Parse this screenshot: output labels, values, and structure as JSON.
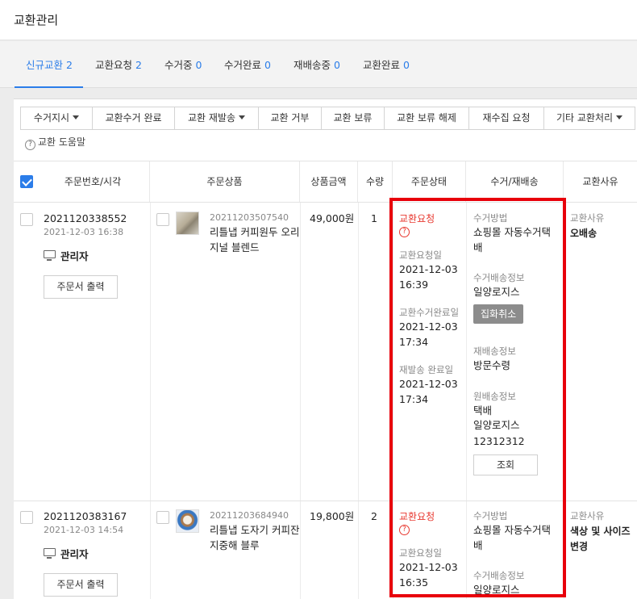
{
  "page_title": "교환관리",
  "tabs": [
    {
      "label": "신규교환",
      "count": "2"
    },
    {
      "label": "교환요청",
      "count": "2"
    },
    {
      "label": "수거중",
      "count": "0"
    },
    {
      "label": "수거완료",
      "count": "0"
    },
    {
      "label": "재배송중",
      "count": "0"
    },
    {
      "label": "교환완료",
      "count": "0"
    }
  ],
  "toolbar": {
    "pickup_instruct": "수거지시",
    "pickup_complete": "교환수거 완료",
    "resend": "교환 재발송",
    "reject": "교환 거부",
    "hold": "교환 보류",
    "hold_release": "교환 보류 해제",
    "recollect": "재수집 요청",
    "other": "기타 교환처리"
  },
  "help_label": "교환 도움말",
  "columns": {
    "order": "주문번호/시각",
    "product": "주문상품",
    "price": "상품금액",
    "qty": "수량",
    "status": "주문상태",
    "pickup": "수거/재배송",
    "reason": "교환사유"
  },
  "rows": [
    {
      "order_no": "2021120338552",
      "order_time": "2021-12-03 16:38",
      "admin": "관리자",
      "print_btn": "주문서 출력",
      "product_no": "20211203507540",
      "product_name": "리틀냅 커피원두 오리지널 블렌드",
      "price": "49,000원",
      "qty": "1",
      "status": "교환요청",
      "request_label": "교환요청일",
      "request_date": "2021-12-03 16:39",
      "pickup_done_label": "교환수거완료일",
      "pickup_done_date": "2021-12-03 17:34",
      "resend_label": "재발송 완료일",
      "resend_date": "2021-12-03 17:34",
      "pickup_method_label": "수거방법",
      "pickup_method": "쇼핑몰 자동수거택배",
      "pickup_ship_label": "수거배송정보",
      "pickup_ship": "일양로지스",
      "cancel_pickup_btn": "집화취소",
      "reship_label": "재배송정보",
      "reship": "방문수령",
      "orig_ship_label": "원배송정보",
      "orig_ship_type": "택배",
      "orig_ship_company": "일양로지스",
      "orig_ship_no": "12312312",
      "lookup_btn": "조회",
      "reason_label": "교환사유",
      "reason": "오배송"
    },
    {
      "order_no": "2021120383167",
      "order_time": "2021-12-03 14:54",
      "admin": "관리자",
      "print_btn": "주문서 출력",
      "product_no": "20211203684940",
      "product_name": "리틀냅 도자기 커피잔 지중해 블루",
      "price": "19,800원",
      "qty": "2",
      "status": "교환요청",
      "request_label": "교환요청일",
      "request_date": "2021-12-03 16:35",
      "pickup_method_label": "수거방법",
      "pickup_method": "쇼핑몰 자동수거택배",
      "pickup_ship_label": "수거배송정보",
      "pickup_ship": "일양로지스",
      "reason_label": "교환사유",
      "reason": "색상 및 사이즈 변경"
    }
  ]
}
